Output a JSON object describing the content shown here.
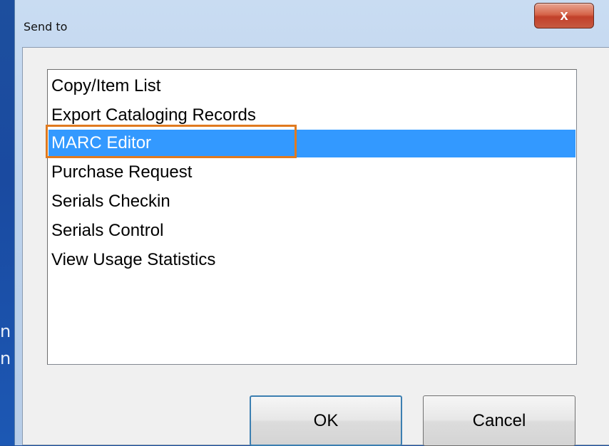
{
  "window": {
    "title": "Send to",
    "close_glyph": "x"
  },
  "background": {
    "line1": "n",
    "line2": "n"
  },
  "list": {
    "items": [
      {
        "label": "Copy/Item List",
        "selected": false
      },
      {
        "label": "Export Cataloging Records",
        "selected": false
      },
      {
        "label": "MARC Editor",
        "selected": true
      },
      {
        "label": "Purchase Request",
        "selected": false
      },
      {
        "label": "Serials Checkin",
        "selected": false
      },
      {
        "label": "Serials Control",
        "selected": false
      },
      {
        "label": "View Usage Statistics",
        "selected": false
      }
    ]
  },
  "buttons": {
    "ok": "OK",
    "cancel": "Cancel"
  },
  "colors": {
    "selection": "#3399ff",
    "highlight": "#e07a1f",
    "close": "#c2402a"
  },
  "icons": {
    "close": "close-icon"
  }
}
